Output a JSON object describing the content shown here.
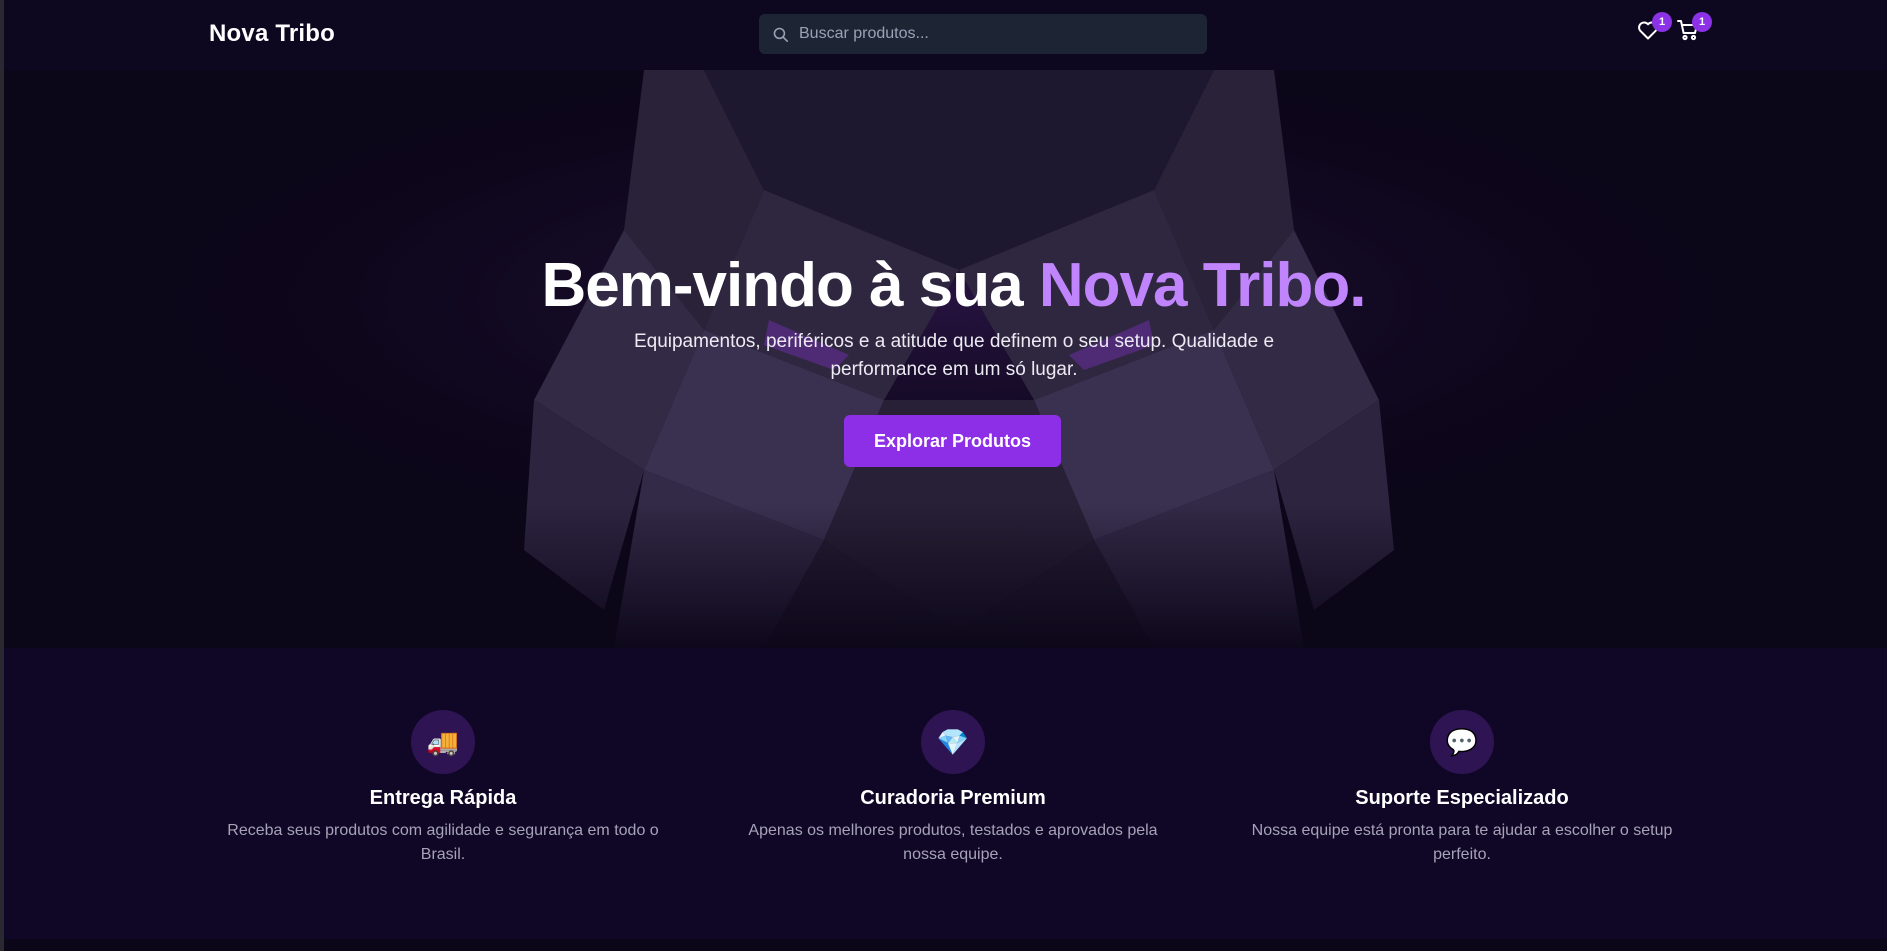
{
  "header": {
    "logo": "Nova Tribo",
    "search": {
      "placeholder": "Buscar produtos...",
      "value": ""
    },
    "wishlist": {
      "icon": "heart-icon",
      "count": "1"
    },
    "cart": {
      "icon": "cart-icon",
      "count": "1"
    }
  },
  "hero": {
    "title_main": "Bem-vindo à sua ",
    "title_accent": "Nova Tribo.",
    "subtitle": "Equipamentos, periféricos e a atitude que definem o seu setup. Qualidade e performance em um só lugar.",
    "cta_label": "Explorar Produtos"
  },
  "features": [
    {
      "icon": "truck-icon",
      "glyph": "🚚",
      "title": "Entrega Rápida",
      "description": "Receba seus produtos com agilidade e segurança em todo o Brasil."
    },
    {
      "icon": "gem-icon",
      "glyph": "💎",
      "title": "Curadoria Premium",
      "description": "Apenas os melhores produtos, testados e aprovados pela nossa equipe."
    },
    {
      "icon": "speech-bubble-icon",
      "glyph": "💬",
      "title": "Suporte Especializado",
      "description": "Nossa equipe está pronta para te ajudar a escolher o setup perfeito."
    }
  ],
  "colors": {
    "background": "#0b0618",
    "accent": "#8e2fe8",
    "accent_text": "#c084fc",
    "badge": "#8b31e6",
    "feature_bg": "#100726",
    "icon_circle": "#2e1453"
  }
}
